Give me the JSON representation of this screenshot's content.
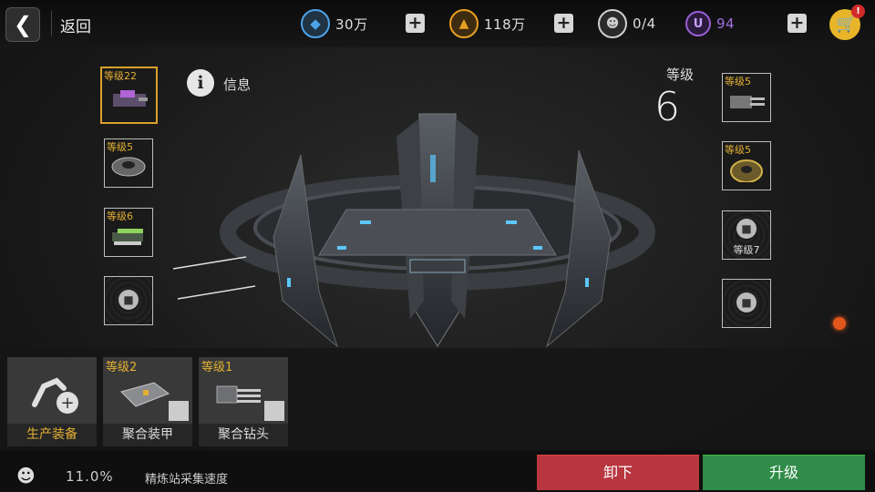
{
  "header": {
    "back_label": "返回",
    "resources": [
      {
        "icon": "crystal-icon",
        "value": "30万",
        "color": "#4da3e8"
      },
      {
        "icon": "gold-icon",
        "value": "118万",
        "color": "#e8a022"
      },
      {
        "icon": "pilot-icon",
        "value": "0/4",
        "color": "#cfcfcf"
      },
      {
        "icon": "u-currency-icon",
        "value": "94",
        "color": "#9a5fd6"
      }
    ],
    "cart_badge": "!"
  },
  "left_slots": [
    {
      "level": "等级22",
      "item": "purple-cannon-icon",
      "selected": true
    },
    {
      "level": "等级5",
      "item": "ring-module-icon",
      "selected": false
    },
    {
      "level": "等级6",
      "item": "green-cannon-icon",
      "selected": false
    },
    {
      "level": "",
      "item": "lock-icon",
      "locked": true
    }
  ],
  "right_slots": [
    {
      "level": "等级5",
      "item": "gatling-icon"
    },
    {
      "level": "等级5",
      "item": "gold-ring-icon"
    },
    {
      "level": "",
      "item": "lock-icon",
      "locked": true,
      "lock_text": "等级7"
    },
    {
      "level": "",
      "item": "lock-icon",
      "locked": true
    }
  ],
  "info": {
    "label": "信息"
  },
  "station": {
    "level_label": "等级",
    "level_value": "6"
  },
  "cards": [
    {
      "name": "生产装备",
      "level": "",
      "icon": "robot-arm-plus-icon",
      "highlight": true
    },
    {
      "name": "聚合装甲",
      "level": "等级2",
      "icon": "armor-plate-icon"
    },
    {
      "name": "聚合钻头",
      "level": "等级1",
      "icon": "drill-icon"
    }
  ],
  "status": {
    "value": "11.0%",
    "label": "精炼站采集速度"
  },
  "buttons": {
    "unload": "卸下",
    "upgrade": "升级"
  }
}
